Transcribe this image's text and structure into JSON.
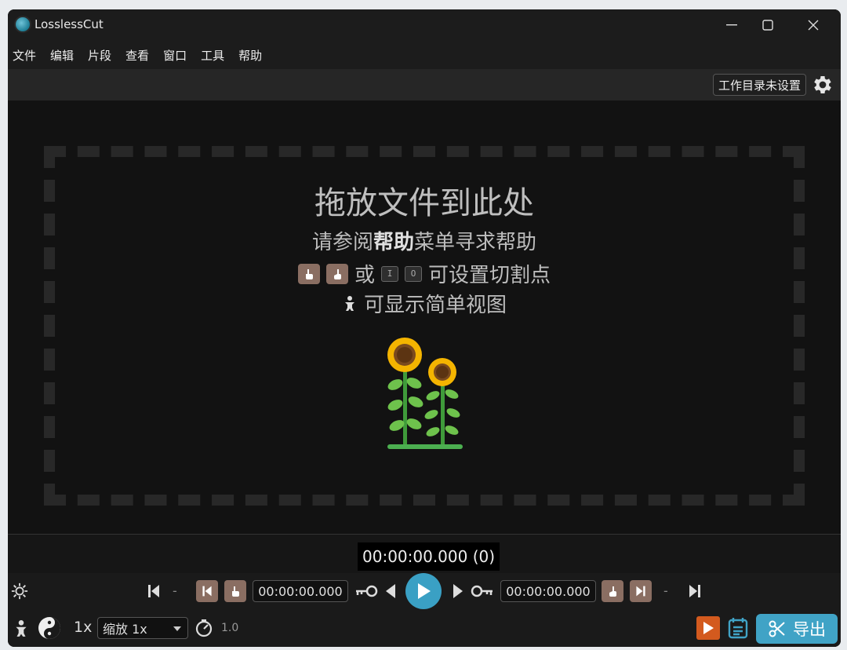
{
  "window": {
    "title": "LosslessCut"
  },
  "menu": {
    "items": [
      "文件",
      "编辑",
      "片段",
      "查看",
      "窗口",
      "工具",
      "帮助"
    ]
  },
  "toolbar": {
    "workdir_label": "工作目录未设置"
  },
  "dropzone": {
    "title": "拖放文件到此处",
    "help_prefix": "请参阅",
    "help_bold": "帮助",
    "help_suffix": "菜单寻求帮助",
    "or_text": "或",
    "key_in": "I",
    "key_out": "O",
    "cut_suffix": "可设置切割点",
    "simple_text": "可显示简单视图"
  },
  "timeline": {
    "current_time": "00:00:00.000 (0)"
  },
  "controls": {
    "start_time": "00:00:00.000",
    "end_time": "00:00:00.000",
    "dash": "-"
  },
  "bottom": {
    "speed": "1x",
    "zoom_value": "缩放 1x",
    "rate": "1.0",
    "export_label": "导出"
  },
  "colors": {
    "accent": "#40a3c6",
    "cut_button": "#8a6e62",
    "record": "#d35a1e"
  }
}
